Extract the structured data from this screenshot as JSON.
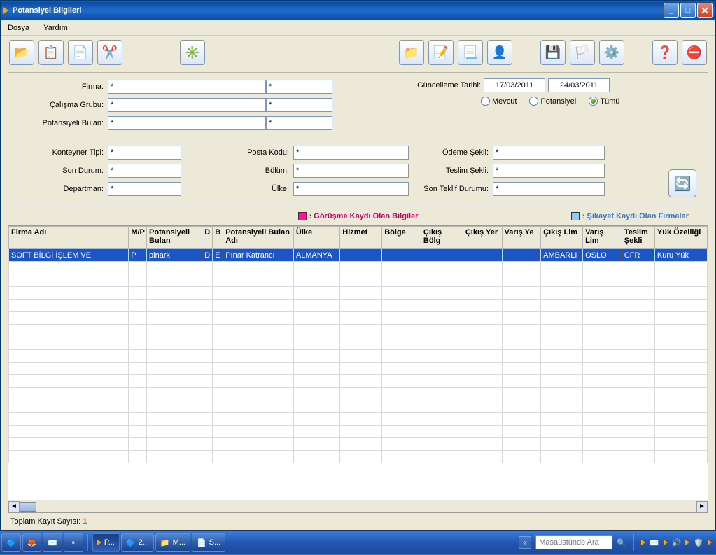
{
  "window": {
    "title": "Potansiyel Bilgileri"
  },
  "menu": {
    "dosya": "Dosya",
    "yardim": "Yardım"
  },
  "filters": {
    "firma_label": "Firma:",
    "firma1": "*",
    "firma2": "*",
    "calisma_label": "Çalışma Grubu:",
    "calisma1": "*",
    "calisma2": "*",
    "potansiyeli_label": "Potansiyeli Bulan:",
    "potansiyeli1": "*",
    "potansiyeli2": "*",
    "guncelleme_label": "Güncelleme Tarihi:",
    "date_from": "17/03/2011",
    "date_to": "24/03/2011",
    "radio_mevcut": "Mevcut",
    "radio_potansiyel": "Potansiyel",
    "radio_tumu": "Tümü",
    "konteyner_label": "Konteyner Tipi:",
    "konteyner": "*",
    "sondurum_label": "Son Durum:",
    "sondurum": "*",
    "departman_label": "Departman:",
    "departman": "*",
    "postakodu_label": "Posta Kodu:",
    "postakodu": "*",
    "bolum_label": "Bölüm:",
    "bolum": "*",
    "ulke_label": "Ülke:",
    "ulke": "*",
    "odeme_label": "Ödeme Şekli:",
    "odeme": "*",
    "teslim_label": "Teslim Şekli:",
    "teslim": "*",
    "sonteklif_label": "Son Teklif Durumu:",
    "sonteklif": "*"
  },
  "legend": {
    "gorusme": ": Görüşme Kaydı Olan Bilgiler",
    "sikayet": ": Şikayet Kaydı Olan Firmalar"
  },
  "grid": {
    "headers": {
      "firma_adi": "Firma Adı",
      "mp": "M/P",
      "potansiyeli_bulan": "Potansiyeli Bulan",
      "d": "D",
      "b": "B",
      "potansiyeli_bulan_adi": "Potansiyeli Bulan Adı",
      "ulke": "Ülke",
      "hizmet": "Hizmet",
      "bolge": "Bölge",
      "cikis_bolge": "Çıkış Bölg",
      "cikis_yeri": "Çıkış Yer",
      "varis_ye": "Varış Ye",
      "cikis_lim": "Çıkış Lim",
      "varis_lim": "Varış Lim",
      "teslim_sekli": "Teslim Şekli",
      "yuk_ozelligi": "Yük Özelliği"
    },
    "rows": [
      {
        "firma_adi": "SOFT BİLGİ İŞLEM VE",
        "mp": "P",
        "potansiyeli_bulan": "pinark",
        "d": "D",
        "b": "E",
        "potansiyeli_bulan_adi": "Pınar Katrancı",
        "ulke": "ALMANYA",
        "hizmet": "",
        "bolge": "",
        "cikis_bolge": "",
        "cikis_yeri": "",
        "varis_ye": "",
        "cikis_lim": "AMBARLI",
        "varis_lim": "OSLO",
        "teslim_sekli": "CFR",
        "yuk_ozelligi": "Kuru Yük"
      }
    ]
  },
  "footer": {
    "toplam_label": "Toplam Kayıt Sayısı:",
    "toplam_value": "1"
  },
  "taskbar": {
    "items": [
      {
        "label": "P..."
      },
      {
        "label": "2..."
      },
      {
        "label": "M..."
      },
      {
        "label": "S..."
      }
    ],
    "search_placeholder": "Masaüstünde Ara"
  }
}
